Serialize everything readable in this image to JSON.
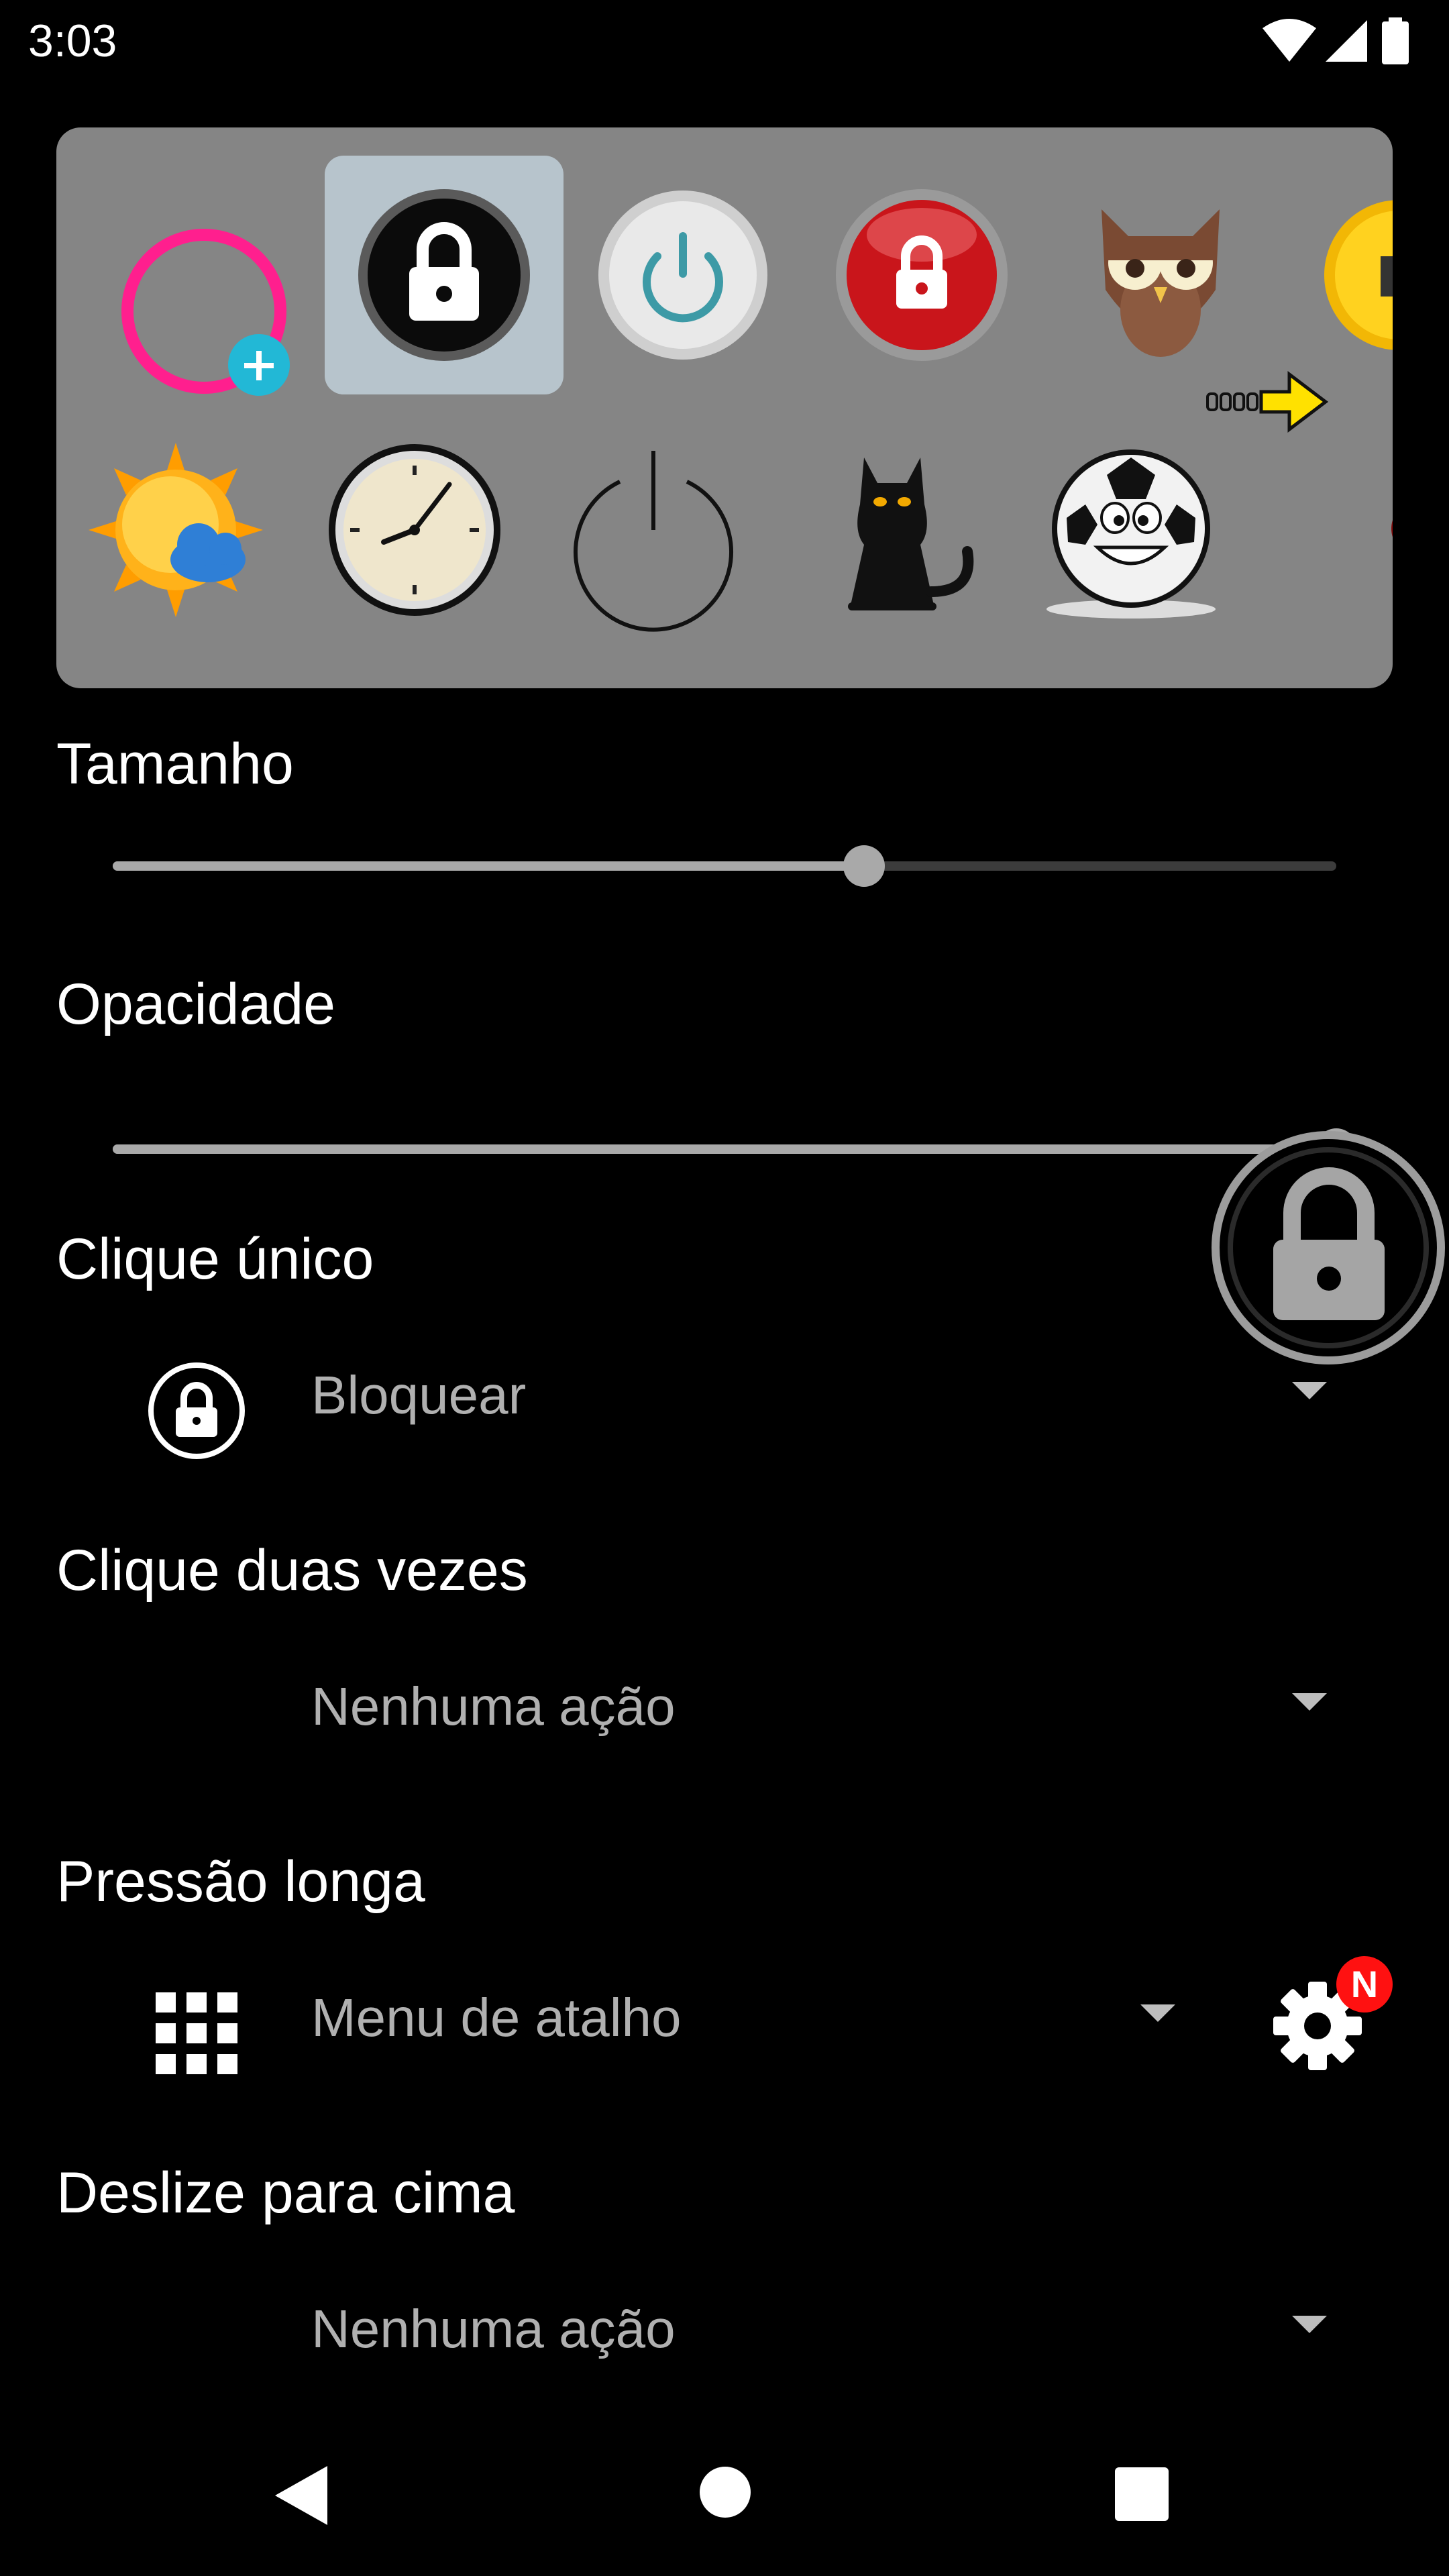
{
  "status_bar": {
    "time": "3:03",
    "icons": [
      "wifi-icon",
      "signal-icon",
      "battery-icon"
    ]
  },
  "icon_picker": {
    "row1": [
      "add-custom-icon",
      "lock-dark-icon",
      "power-white-icon",
      "lock-red-icon",
      "owl-icon",
      "emoji-partial-icon"
    ],
    "row2": [
      "sun-cloud-icon",
      "clock-icon",
      "power-outline-icon",
      "black-cat-icon",
      "soccer-ball-face-icon",
      "red-dots-partial-icon"
    ],
    "selected": "lock-dark-icon",
    "scroll_hint": "arrow-right-icon"
  },
  "size": {
    "label": "Tamanho",
    "value_fraction": 0.614
  },
  "opacity": {
    "label": "Opacidade",
    "value_fraction": 1.0
  },
  "single_click": {
    "label": "Clique único",
    "action": "Bloquear",
    "icon": "lock-circle-icon"
  },
  "double_click": {
    "label": "Clique duas vezes",
    "action": "Nenhuma ação"
  },
  "long_press": {
    "label": "Pressão longa",
    "action": "Menu de atalho",
    "icon": "grid-icon",
    "settings_badge": "N"
  },
  "swipe_up": {
    "label": "Deslize para cima",
    "action": "Nenhuma ação"
  },
  "nav": [
    "back-icon",
    "home-icon",
    "recents-icon"
  ],
  "colors": {
    "background": "#000000",
    "panel": "#858585",
    "selected_cell": "#b7c4cc",
    "accent_pink": "#ff1f8e",
    "accent_cyan": "#22b8d6",
    "badge_red": "#ff1111"
  }
}
